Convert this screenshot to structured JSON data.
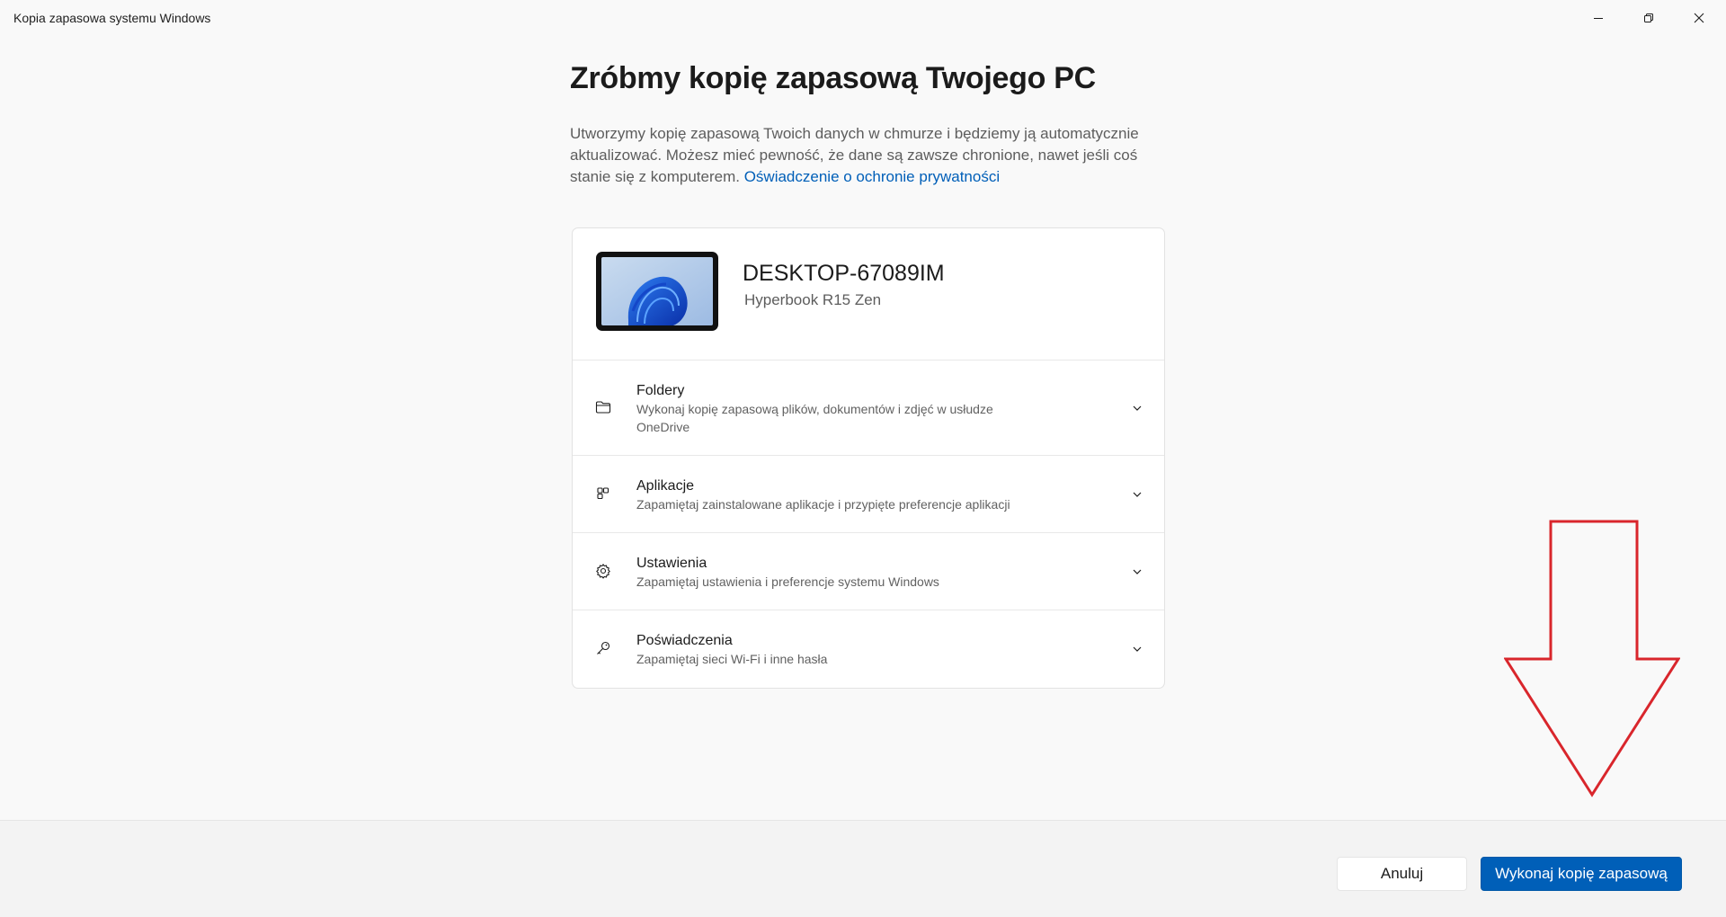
{
  "window": {
    "title": "Kopia zapasowa systemu Windows"
  },
  "main": {
    "heading": "Zróbmy kopię zapasową Twojego PC",
    "description": "Utworzymy kopię zapasową Twoich danych w chmurze i będziemy ją automatycznie aktualizować. Możesz mieć pewność, że dane są zawsze chronione, nawet jeśli coś stanie się z komputerem.",
    "privacy_link": "Oświadczenie o ochronie prywatności"
  },
  "device": {
    "name": "DESKTOP-67089IM",
    "model": "Hyperbook R15 Zen"
  },
  "sections": [
    {
      "title": "Foldery",
      "subtitle": "Wykonaj kopię zapasową plików, dokumentów i zdjęć w usłudze OneDrive",
      "icon": "folder-icon"
    },
    {
      "title": "Aplikacje",
      "subtitle": "Zapamiętaj zainstalowane aplikacje i przypięte preferencje aplikacji",
      "icon": "apps-icon"
    },
    {
      "title": "Ustawienia",
      "subtitle": "Zapamiętaj ustawienia i preferencje systemu Windows",
      "icon": "gear-icon"
    },
    {
      "title": "Poświadczenia",
      "subtitle": "Zapamiętaj sieci Wi-Fi i inne hasła",
      "icon": "key-icon"
    }
  ],
  "footer": {
    "cancel_label": "Anuluj",
    "backup_label": "Wykonaj kopię zapasową"
  },
  "colors": {
    "accent": "#005fb8",
    "annotation_arrow": "#d9262c"
  }
}
